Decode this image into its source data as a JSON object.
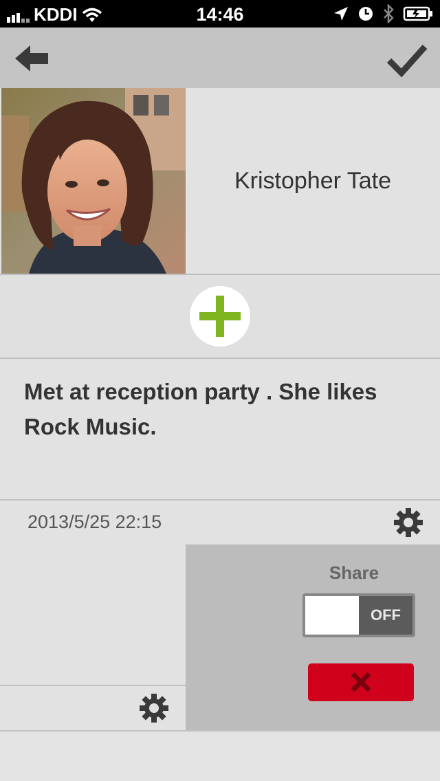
{
  "status_bar": {
    "carrier": "KDDI",
    "time": "14:46",
    "icons": [
      "signal-icon",
      "wifi-icon",
      "location-icon",
      "alarm-icon",
      "bluetooth-icon",
      "battery-icon"
    ]
  },
  "nav": {
    "back_icon": "back-arrow-icon",
    "done_icon": "checkmark-icon"
  },
  "contact": {
    "name": "Kristopher Tate"
  },
  "add_button_icon": "plus-icon",
  "note": {
    "text": "Met at reception party . She likes Rock Music."
  },
  "meta": {
    "datetime": "2013/5/25 22:15"
  },
  "share": {
    "label": "Share",
    "toggle_state": "OFF"
  },
  "colors": {
    "add_accent": "#7fb61f",
    "delete": "#d0021b",
    "nav_bg": "#c4c4c4",
    "panel_bg": "#bcbcbc"
  }
}
